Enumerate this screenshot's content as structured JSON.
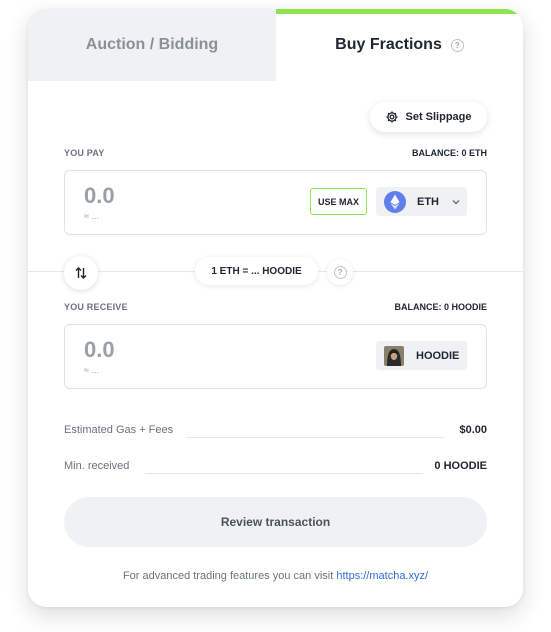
{
  "tabs": {
    "auction": "Auction / Bidding",
    "buy": "Buy Fractions"
  },
  "colors": {
    "accent": "#8ee34f",
    "link": "#2f6fd8",
    "eth": "#627eea"
  },
  "slippage": {
    "label": "Set Slippage",
    "icon": "gear-icon"
  },
  "pay": {
    "label": "YOU PAY",
    "balance": "BALANCE: 0 ETH",
    "amount": "0.0",
    "fiat": "≈ ...",
    "use_max": "USE MAX",
    "token": "ETH",
    "token_icon": "ethereum-icon"
  },
  "rate": {
    "text": "1 ETH = ... HOODIE",
    "help": "?"
  },
  "receive": {
    "label": "YOU RECEIVE",
    "balance": "BALANCE: 0 HOODIE",
    "amount": "0.0",
    "fiat": "≈ ...",
    "token": "HOODIE",
    "token_icon": "hoodie-token-icon"
  },
  "fees": {
    "gas_label": "Estimated Gas + Fees",
    "gas_value": "$0.00",
    "min_label": "Min. received",
    "min_value": "0 HOODIE"
  },
  "review_button": "Review transaction",
  "footer": {
    "text": "For advanced trading features you can visit",
    "link": "https://matcha.xyz/"
  }
}
